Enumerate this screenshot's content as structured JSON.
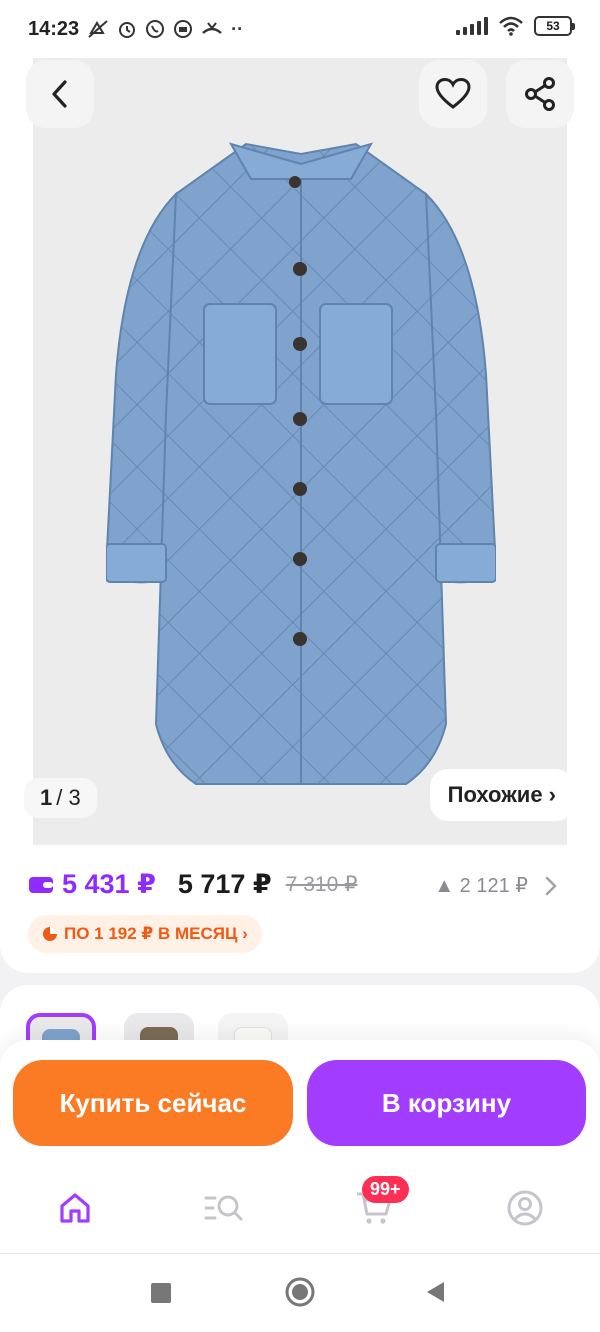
{
  "status_bar": {
    "time": "14:23",
    "battery": "53"
  },
  "gallery": {
    "counter_current": "1",
    "counter_total": "/ 3",
    "similar_label": "Похожие ›"
  },
  "price": {
    "wallet_price": "5 431 ₽",
    "main_price": "5 717 ₽",
    "old_price": "7 310 ₽",
    "discount": "▲ 2 121 ₽",
    "installment": "ПО 1 192 ₽ В МЕСЯЦ ›"
  },
  "actions": {
    "buy_now": "Купить сейчас",
    "add_to_cart": "В корзину"
  },
  "bottom_nav": {
    "cart_badge": "99+"
  },
  "colors": {
    "accent_purple": "#a23cff",
    "accent_orange": "#fb7a24",
    "badge_red": "#ff2e55",
    "coat_blue": "#7fa3cc"
  }
}
